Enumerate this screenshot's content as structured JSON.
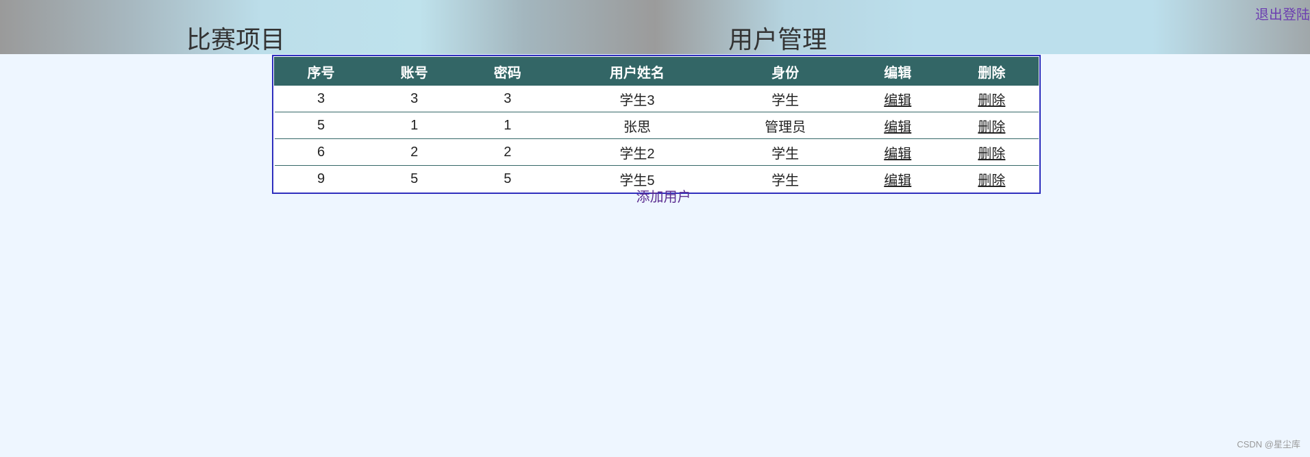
{
  "header": {
    "logout_label": "退出登陆",
    "nav_left": "比赛项目",
    "nav_right": "用户管理"
  },
  "table": {
    "columns": [
      "序号",
      "账号",
      "密码",
      "用户姓名",
      "身份",
      "编辑",
      "删除"
    ],
    "rows": [
      {
        "id": "3",
        "account": "3",
        "password": "3",
        "name": "学生3",
        "role": "学生",
        "edit": "编辑",
        "delete": "删除"
      },
      {
        "id": "5",
        "account": "1",
        "password": "1",
        "name": "张思",
        "role": "管理员",
        "edit": "编辑",
        "delete": "删除"
      },
      {
        "id": "6",
        "account": "2",
        "password": "2",
        "name": "学生2",
        "role": "学生",
        "edit": "编辑",
        "delete": "删除"
      },
      {
        "id": "9",
        "account": "5",
        "password": "5",
        "name": "学生5",
        "role": "学生",
        "edit": "编辑",
        "delete": "删除"
      }
    ]
  },
  "add_user_label": "添加用户",
  "watermark": "CSDN @星尘库"
}
